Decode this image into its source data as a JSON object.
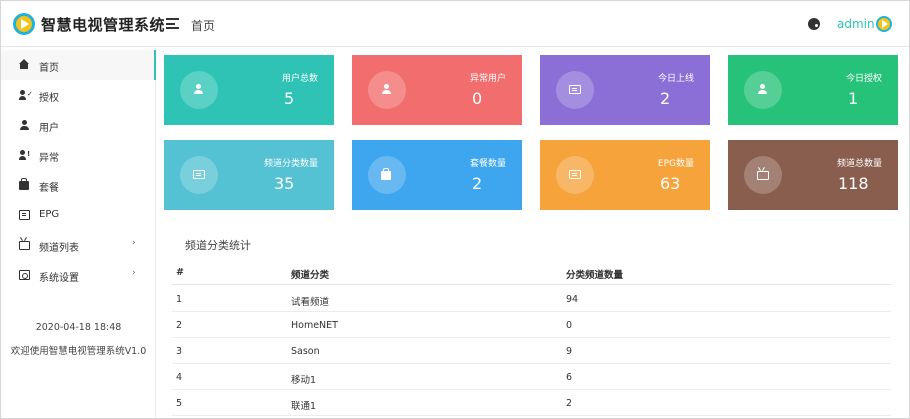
{
  "app": {
    "title": "智慧电视管理系统",
    "breadcrumb": "首页",
    "user": "admin",
    "accent": "#2ec3b5"
  },
  "sidebar": {
    "items": [
      {
        "label": "首页",
        "icon": "home-icon",
        "active": true
      },
      {
        "label": "授权",
        "icon": "user-check-icon"
      },
      {
        "label": "用户",
        "icon": "user-icon"
      },
      {
        "label": "异常",
        "icon": "user-alert-icon"
      },
      {
        "label": "套餐",
        "icon": "bag-icon"
      },
      {
        "label": "EPG",
        "icon": "epg-icon"
      },
      {
        "label": "频道列表",
        "icon": "tv-icon",
        "expandable": true
      },
      {
        "label": "系统设置",
        "icon": "settings-icon",
        "expandable": true
      }
    ],
    "date": "2020-04-18 18:48",
    "welcome": "欢迎使用智慧电视管理系统V1.0"
  },
  "cards": [
    {
      "label": "用户总数",
      "value": "5",
      "color": "#2ec3b5",
      "icon": "user-icon"
    },
    {
      "label": "异常用户",
      "value": "0",
      "color": "#f26d6d",
      "icon": "user-alert-icon"
    },
    {
      "label": "今日上线",
      "value": "2",
      "color": "#8b6fd6",
      "icon": "login-icon"
    },
    {
      "label": "今日授权",
      "value": "1",
      "color": "#27c27a",
      "icon": "user-check-icon"
    },
    {
      "label": "频道分类数量",
      "value": "35",
      "color": "#55c2d3",
      "icon": "list-icon"
    },
    {
      "label": "套餐数量",
      "value": "2",
      "color": "#3ea6ee",
      "icon": "bag-icon"
    },
    {
      "label": "EPG数量",
      "value": "63",
      "color": "#f7a33b",
      "icon": "epg-icon"
    },
    {
      "label": "频道总数量",
      "value": "118",
      "color": "#8a5e4f",
      "icon": "tv-icon"
    }
  ],
  "stats": {
    "title": "频道分类统计",
    "columns": [
      "#",
      "频道分类",
      "分类频道数量"
    ],
    "rows": [
      [
        "1",
        "试看频道",
        "94"
      ],
      [
        "2",
        "HomeNET",
        "0"
      ],
      [
        "3",
        "Sason",
        "9"
      ],
      [
        "4",
        "移动1",
        "6"
      ],
      [
        "5",
        "联通1",
        "2"
      ]
    ]
  }
}
